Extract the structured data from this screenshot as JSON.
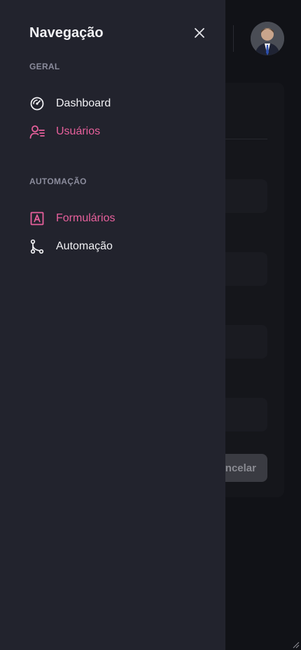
{
  "drawer": {
    "title": "Navegação",
    "sections": [
      {
        "label": "GERAL",
        "items": [
          {
            "label": "Dashboard",
            "icon": "gauge-icon",
            "active": false
          },
          {
            "label": "Usuários",
            "icon": "users-list-icon",
            "active": true
          }
        ]
      },
      {
        "label": "AUTOMAÇÃO",
        "items": [
          {
            "label": "Formulários",
            "icon": "form-letter-icon",
            "active": true
          },
          {
            "label": "Automação",
            "icon": "workflow-icon",
            "active": false
          }
        ]
      }
    ]
  },
  "background": {
    "cancel_label": "ncelar"
  },
  "colors": {
    "accent": "#e8609c",
    "drawer_bg": "#22232d",
    "page_bg": "#111217"
  }
}
